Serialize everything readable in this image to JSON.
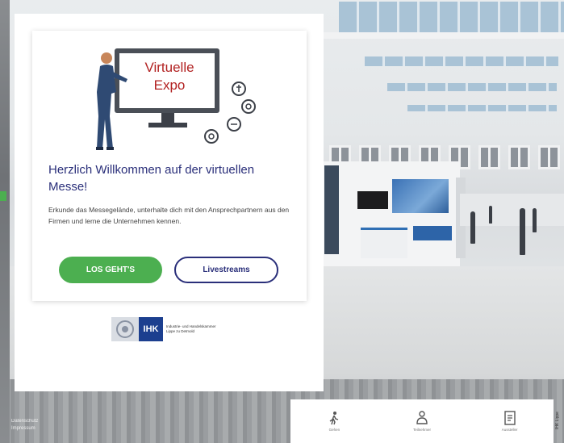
{
  "illustration": {
    "title_line1": "Virtuelle",
    "title_line2": "Expo",
    "screen_color": "#b22222"
  },
  "welcome": {
    "heading": "Herzlich Willkommen auf der virtuellen Messe!",
    "text": "Erkunde das Messegelände, unterhalte dich mit den Ansprechpartnern aus den Firmen und lerne die Unternehmen kennen."
  },
  "buttons": {
    "primary_label": "LOS GEHT'S",
    "secondary_label": "Livestreams"
  },
  "logo": {
    "mark": "IHK",
    "subtitle": "Industrie- und Handelskammer Lippe zu Detmold"
  },
  "caption": {
    "line1": "Datenschutz",
    "line2": "Impressum"
  },
  "nav": {
    "items": [
      {
        "label": "Gehen",
        "icon": "walk-icon"
      },
      {
        "label": "Teilnehmer",
        "icon": "person-icon"
      },
      {
        "label": "Aussteller",
        "icon": "document-icon"
      }
    ]
  },
  "side_note": "IHK Lippe",
  "colors": {
    "accent_green": "#4caf50",
    "navy": "#2a2f7a",
    "expo_red": "#b22222",
    "ihk_blue": "#1c3f8f"
  }
}
